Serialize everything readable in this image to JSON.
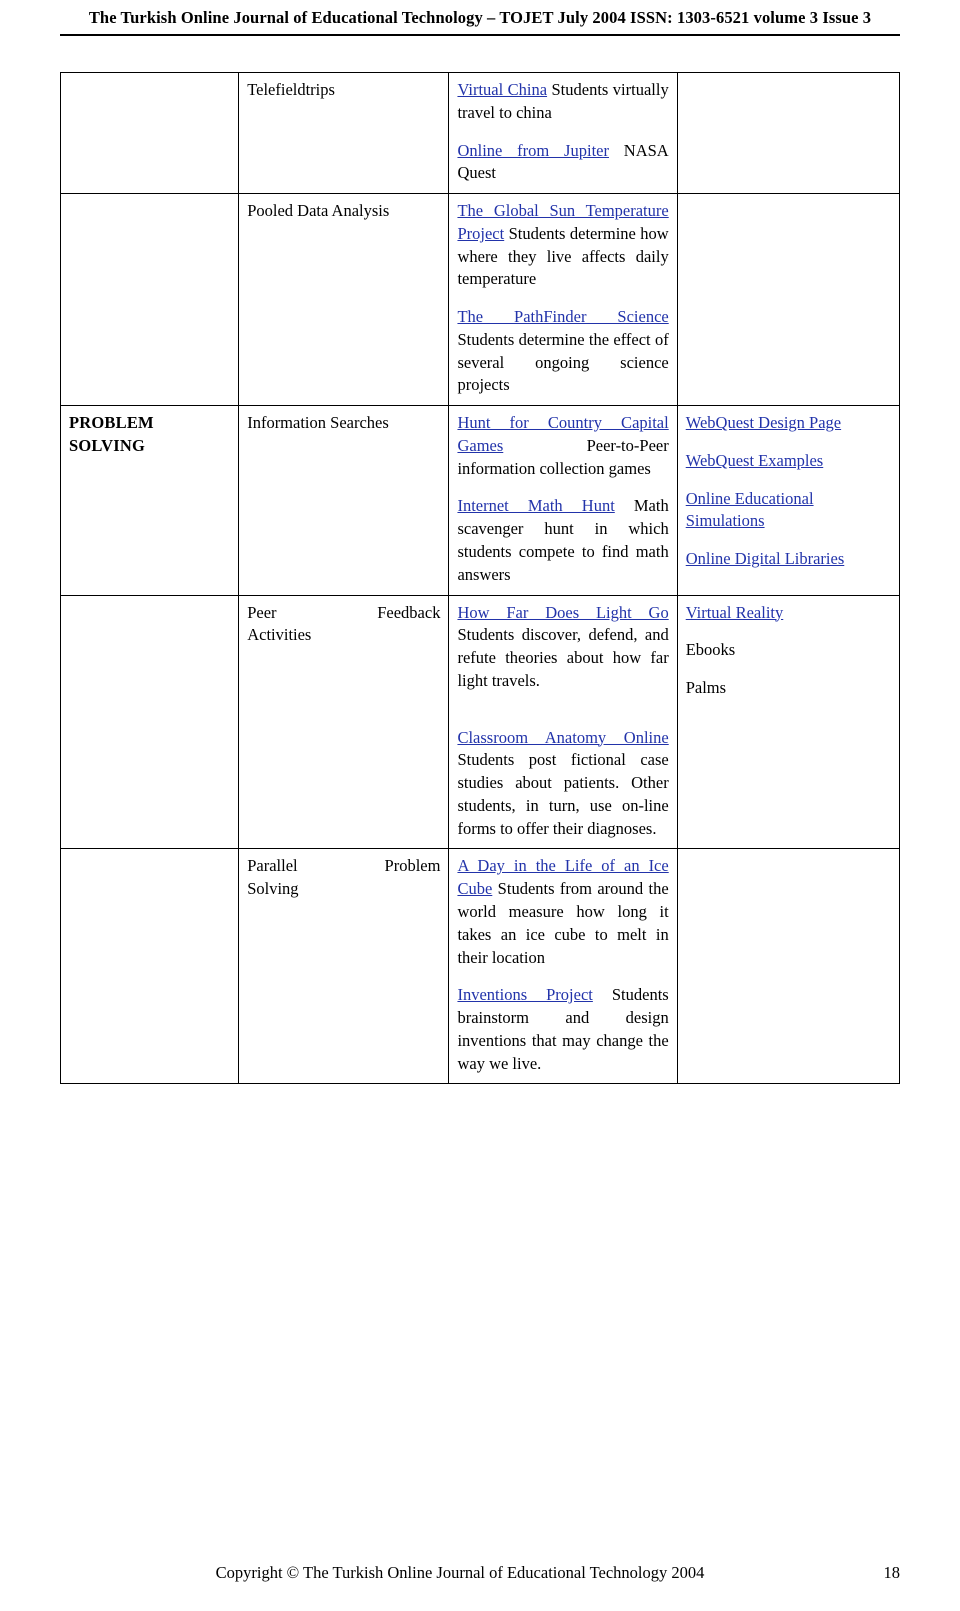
{
  "header": {
    "running_head": "The Turkish Online Journal of Educational Technology – TOJET July 2004 ISSN: 1303-6521 volume 3 Issue 3"
  },
  "footer": {
    "copyright": "Copyright © The Turkish Online Journal of Educational Technology 2004",
    "page_number": "18"
  },
  "colors": {
    "link": "#2233aa",
    "text": "#000000"
  },
  "table": {
    "rows": [
      {
        "category": "",
        "strategy": "Telefieldtrips",
        "examples": [
          {
            "link": "Virtual China",
            "text": " Students virtually travel to china"
          },
          {
            "link": "Online from Jupiter",
            "text": " NASA Quest"
          }
        ],
        "resources": []
      },
      {
        "category": "",
        "strategy": "Pooled Data Analysis",
        "examples": [
          {
            "link": "The Global Sun Temperature Project",
            "text": " Students determine how where they live affects daily temperature"
          },
          {
            "link": "The PathFinder Science",
            "text": " Students determine the effect of several ongoing science projects"
          }
        ],
        "resources": []
      },
      {
        "category": "PROBLEM SOLVING",
        "strategy": "Information Searches",
        "examples": [
          {
            "link": "Hunt for Country Capital Games",
            "text": " Peer-to-Peer information collection games"
          },
          {
            "link": "Internet Math Hunt",
            "text": " Math scavenger hunt in which students compete to find math answers"
          }
        ],
        "resources": [
          {
            "link": "WebQuest Design Page",
            "text": ""
          },
          {
            "link": "WebQuest Examples",
            "text": ""
          },
          {
            "link": "Online Educational Simulations",
            "text": ""
          },
          {
            "link": "Online Digital Libraries",
            "text": ""
          }
        ]
      },
      {
        "category": "",
        "strategy_left": "Peer",
        "strategy_right": "Feedback",
        "strategy_second_line": "Activities",
        "examples": [
          {
            "link": "How Far Does Light Go",
            "text": " Students discover, defend, and refute theories about how far light travels."
          },
          {
            "link": "Classroom Anatomy Online",
            "text": " Students post fictional case studies about patients. Other students, in turn, use on-line forms to offer their diagnoses."
          }
        ],
        "resources": [
          {
            "link": "Virtual Reality",
            "text": ""
          },
          {
            "link": "",
            "text": "Ebooks"
          },
          {
            "link": "",
            "text": "Palms"
          }
        ]
      },
      {
        "category": "",
        "strategy_left": "Parallel",
        "strategy_right": "Problem",
        "strategy_second_line": "Solving",
        "examples": [
          {
            "link": "A Day in the Life of an Ice Cube",
            "text": " Students from around the world measure how long it takes an ice cube to melt in their location"
          },
          {
            "link": "Inventions Project",
            "text": " Students brainstorm and design inventions that may change the way we live."
          }
        ],
        "resources": []
      }
    ]
  }
}
